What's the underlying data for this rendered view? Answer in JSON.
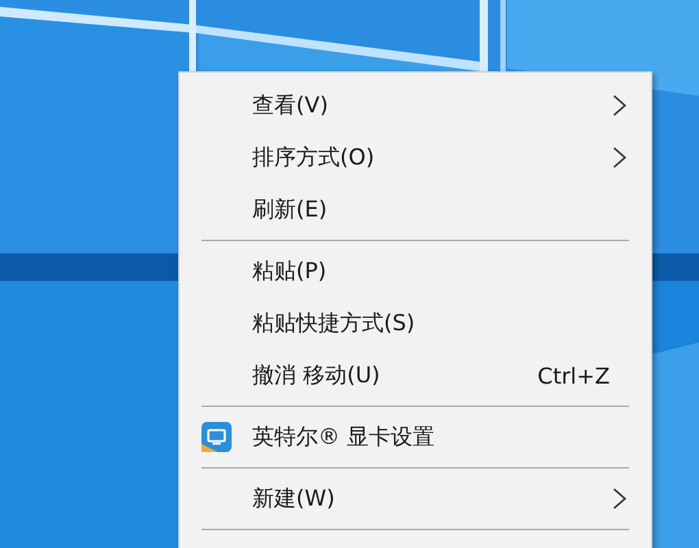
{
  "context_menu": {
    "items": [
      {
        "kind": "item",
        "label": "查看(V)",
        "submenu": true
      },
      {
        "kind": "item",
        "label": "排序方式(O)",
        "submenu": true
      },
      {
        "kind": "item",
        "label": "刷新(E)",
        "submenu": false
      },
      {
        "kind": "separator"
      },
      {
        "kind": "item",
        "label": "粘贴(P)",
        "submenu": false
      },
      {
        "kind": "item",
        "label": "粘贴快捷方式(S)",
        "submenu": false
      },
      {
        "kind": "item",
        "label": "撤消 移动(U)",
        "shortcut": "Ctrl+Z",
        "submenu": false
      },
      {
        "kind": "separator"
      },
      {
        "kind": "icon_item",
        "label": "英特尔® 显卡设置",
        "submenu": false
      },
      {
        "kind": "separator"
      },
      {
        "kind": "item",
        "label": "新建(W)",
        "submenu": true
      },
      {
        "kind": "separator"
      }
    ]
  }
}
